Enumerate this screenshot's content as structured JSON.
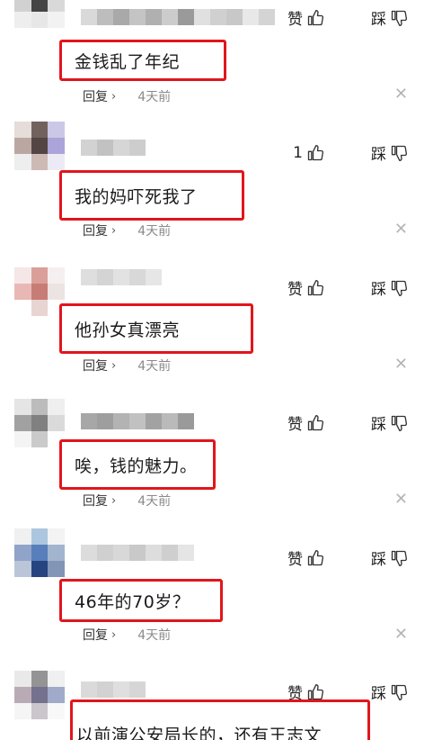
{
  "comments": [
    {
      "text": "金钱乱了年纪",
      "like": "赞",
      "dislike": "踩",
      "reply": "回复",
      "time": "4天前"
    },
    {
      "text": "我的妈吓死我了",
      "like": "1",
      "dislike": "踩",
      "reply": "回复",
      "time": "4天前"
    },
    {
      "text": "他孙女真漂亮",
      "like": "赞",
      "dislike": "踩",
      "reply": "回复",
      "time": "4天前"
    },
    {
      "text": "唉，钱的魅力。",
      "like": "赞",
      "dislike": "踩",
      "reply": "回复",
      "time": "4天前"
    },
    {
      "text": "46年的70岁？",
      "like": "赞",
      "dislike": "踩",
      "reply": "回复",
      "time": "4天前"
    },
    {
      "text": "以前演公安局长的，还有王志文",
      "like": "赞",
      "dislike": "踩"
    }
  ],
  "icons": {
    "like": "thumbs-up-icon",
    "dislike": "thumbs-down-icon",
    "close": "close-icon",
    "chevron": "chevron-right-icon"
  },
  "colors": {
    "highlight_border": "#e0161c",
    "time_text": "#8a8a8a"
  }
}
